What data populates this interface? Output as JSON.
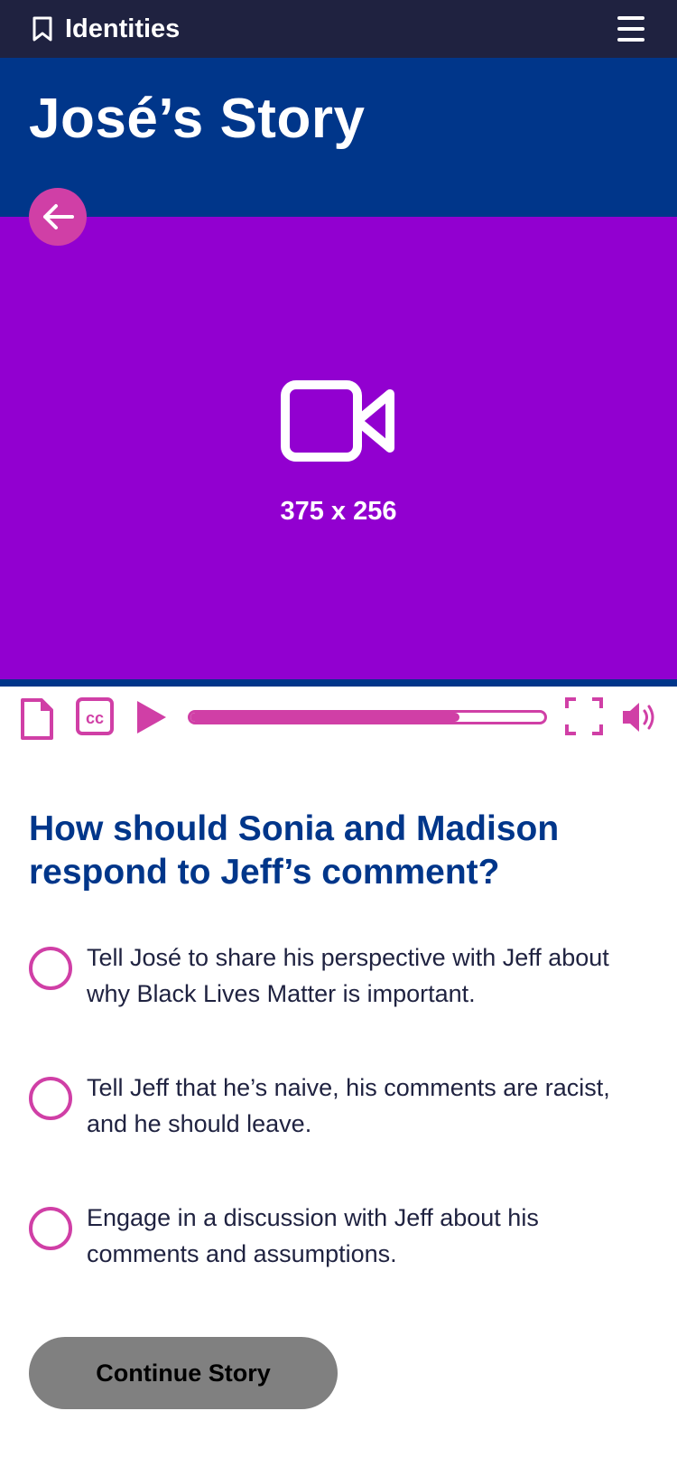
{
  "topbar": {
    "brand": "Identities",
    "bookmark_icon": "bookmark-icon",
    "menu_icon": "hamburger-menu-icon"
  },
  "header": {
    "title": "José’s Story"
  },
  "video": {
    "placeholder_dims": "375 x 256",
    "icon": "video-camera-icon",
    "background": "#9200d0"
  },
  "back_button": {
    "icon": "arrow-left-icon",
    "color": "#d03fa6"
  },
  "player": {
    "progress": 0.76,
    "icons": [
      "transcript-icon",
      "closed-captions-icon",
      "play-icon",
      "fullscreen-icon",
      "volume-icon"
    ],
    "cc_label": "cc"
  },
  "question": {
    "text": "How should Sonia and Madison respond to Jeff’s comment?"
  },
  "options": [
    {
      "label": "Tell José to share his perspective with Jeff about why Black Lives Matter is important."
    },
    {
      "label": "Tell Jeff that he’s naive, his comments are racist, and he should leave."
    },
    {
      "label": "Engage in a discussion with Jeff about his comments and assumptions."
    }
  ],
  "continue_button": {
    "label": "Continue Story"
  },
  "colors": {
    "navy": "#1f2240",
    "blue": "#00368a",
    "purple": "#9200d0",
    "accent": "#d03fa6",
    "button_gray": "#808080"
  }
}
